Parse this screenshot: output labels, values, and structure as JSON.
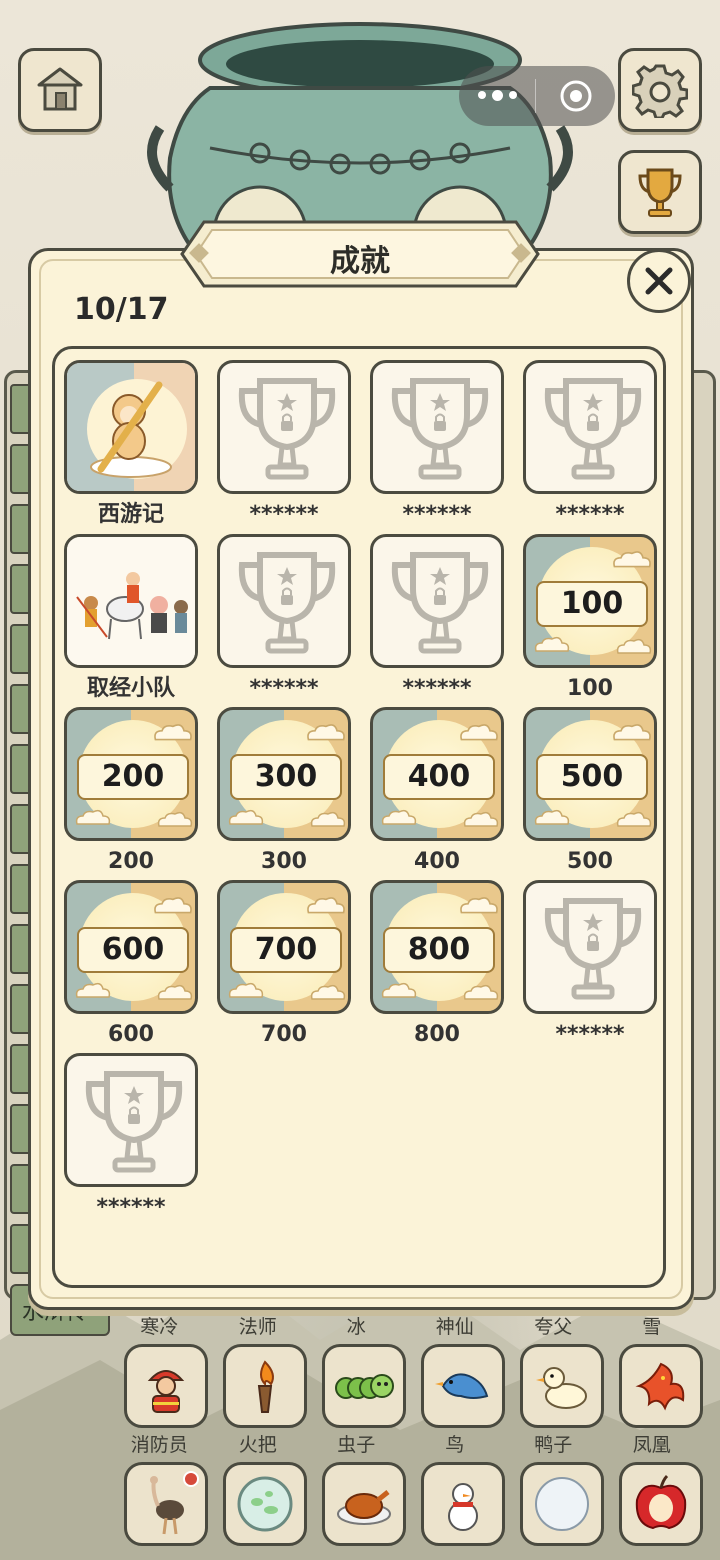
{
  "header": {
    "home_icon": "home-icon",
    "settings_icon": "gear-icon",
    "trophy_icon": "trophy-icon"
  },
  "capsule": {
    "more_icon": "more-dots-icon",
    "close_icon": "target-icon"
  },
  "dialog": {
    "title": "成就",
    "progress": "10/17",
    "close_icon": "close-icon",
    "achievements": [
      {
        "label": "西游记",
        "state": "unlocked-art"
      },
      {
        "label": "******",
        "state": "locked"
      },
      {
        "label": "******",
        "state": "locked"
      },
      {
        "label": "******",
        "state": "locked"
      },
      {
        "label": "取经小队",
        "state": "unlocked-art"
      },
      {
        "label": "******",
        "state": "locked"
      },
      {
        "label": "******",
        "state": "locked"
      },
      {
        "label": "100",
        "state": "coin",
        "amount": "100"
      },
      {
        "label": "200",
        "state": "coin",
        "amount": "200"
      },
      {
        "label": "300",
        "state": "coin",
        "amount": "300"
      },
      {
        "label": "400",
        "state": "coin",
        "amount": "400"
      },
      {
        "label": "500",
        "state": "coin",
        "amount": "500"
      },
      {
        "label": "600",
        "state": "coin",
        "amount": "600"
      },
      {
        "label": "700",
        "state": "coin",
        "amount": "700"
      },
      {
        "label": "800",
        "state": "coin",
        "amount": "800"
      },
      {
        "label": "******",
        "state": "locked"
      },
      {
        "label": "******",
        "state": "locked"
      }
    ]
  },
  "behind_tab_label": "水浒传",
  "bottom": {
    "row1_labels": [
      "寒冷",
      "法师",
      "冰",
      "神仙",
      "夸父",
      "雪"
    ],
    "row2_labels": [
      "消防员",
      "火把",
      "虫子",
      "鸟",
      "鸭子",
      "凤凰"
    ],
    "row1_icons": [
      "firefighter-icon",
      "torch-icon",
      "caterpillar-icon",
      "bird-icon",
      "duck-icon",
      "phoenix-icon"
    ],
    "row2_icons": [
      "ostrich-icon",
      "petri-dish-icon",
      "roast-chicken-icon",
      "snowman-icon",
      "snowball-icon",
      "apple-icon"
    ]
  },
  "colors": {
    "panel_bg": "#fbf3d8",
    "border": "#4b4b40",
    "coin_left": "#a9bdb5",
    "coin_right": "#e9c88c"
  }
}
